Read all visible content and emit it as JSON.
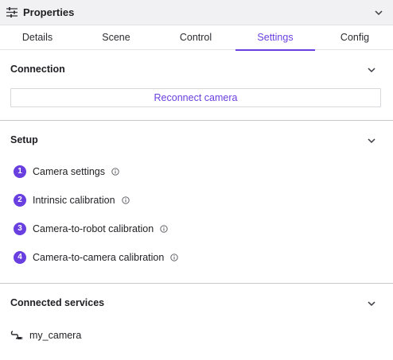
{
  "panel": {
    "title": "Properties"
  },
  "tabs": [
    {
      "label": "Details"
    },
    {
      "label": "Scene"
    },
    {
      "label": "Control"
    },
    {
      "label": "Settings",
      "active": true
    },
    {
      "label": "Config"
    }
  ],
  "connection": {
    "title": "Connection",
    "reconnect_label": "Reconnect camera"
  },
  "setup": {
    "title": "Setup",
    "steps": [
      {
        "number": "1",
        "label": "Camera settings"
      },
      {
        "number": "2",
        "label": "Intrinsic calibration"
      },
      {
        "number": "3",
        "label": "Camera-to-robot calibration"
      },
      {
        "number": "4",
        "label": "Camera-to-camera calibration"
      }
    ]
  },
  "services": {
    "title": "Connected services",
    "items": [
      {
        "name": "my_camera",
        "icon": "camera-cable-icon"
      }
    ]
  },
  "colors": {
    "accent": "#6a3fe0",
    "header_bg": "#f1f1f3",
    "divider": "#c9c9cd"
  }
}
